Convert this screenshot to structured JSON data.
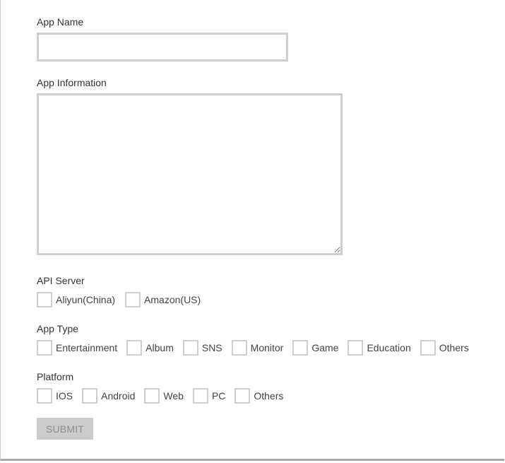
{
  "form": {
    "app_name": {
      "label": "App Name",
      "value": "",
      "placeholder": ""
    },
    "app_information": {
      "label": "App Information",
      "value": "",
      "placeholder": ""
    },
    "api_server": {
      "label": "API Server",
      "options": [
        {
          "label": "Aliyun(China)",
          "checked": false
        },
        {
          "label": "Amazon(US)",
          "checked": false
        }
      ]
    },
    "app_type": {
      "label": "App Type",
      "options": [
        {
          "label": "Entertainment",
          "checked": false
        },
        {
          "label": "Album",
          "checked": false
        },
        {
          "label": "SNS",
          "checked": false
        },
        {
          "label": "Monitor",
          "checked": false
        },
        {
          "label": "Game",
          "checked": false
        },
        {
          "label": "Education",
          "checked": false
        },
        {
          "label": "Others",
          "checked": false
        }
      ]
    },
    "platform": {
      "label": "Platform",
      "options": [
        {
          "label": "IOS",
          "checked": false
        },
        {
          "label": "Android",
          "checked": false
        },
        {
          "label": "Web",
          "checked": false
        },
        {
          "label": "PC",
          "checked": false
        },
        {
          "label": "Others",
          "checked": false
        }
      ]
    },
    "submit_label": "SUBMIT"
  },
  "colors": {
    "input_border": "#cfcfcf",
    "submit_bg": "#cccccc",
    "submit_text": "#8e8e8e",
    "label_text": "#333333"
  }
}
